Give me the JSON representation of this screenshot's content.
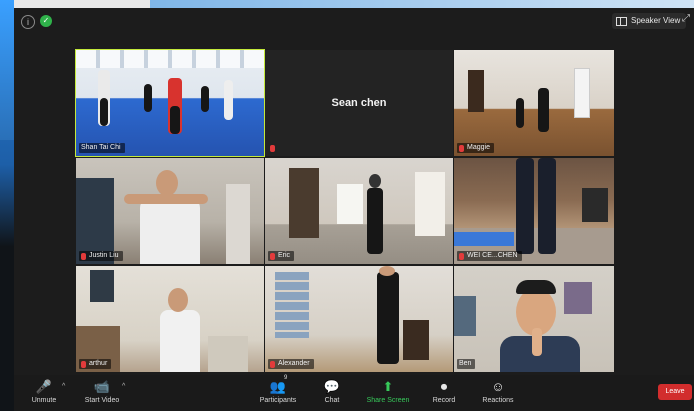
{
  "topbar": {
    "speaker_view_label": "Speaker View"
  },
  "participants": [
    {
      "name": "Shan Tai Chi",
      "active": true
    },
    {
      "name": "Sean chen",
      "video": false
    },
    {
      "name": "Maggie"
    },
    {
      "name": "Justin Liu"
    },
    {
      "name": "Eric"
    },
    {
      "name": "WEI CE...CHEN"
    },
    {
      "name": "arthur"
    },
    {
      "name": "Alexander"
    },
    {
      "name": "Ben"
    }
  ],
  "toolbar": {
    "unmute": "Unmute",
    "start_video": "Start Video",
    "participants": "Participants",
    "participants_count": "9",
    "chat": "Chat",
    "share_screen": "Share Screen",
    "record": "Record",
    "reactions": "Reactions",
    "leave": "Leave"
  },
  "colors": {
    "active_speaker": "#c4ea3b",
    "leave": "#d22d2d",
    "share": "#37c95a"
  }
}
